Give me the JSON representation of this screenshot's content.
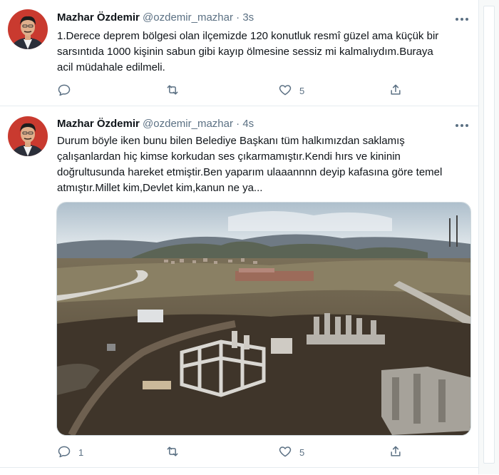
{
  "tweets": [
    {
      "name": "Mazhar Özdemir",
      "handle": "@ozdemir_mazhar",
      "dot": "·",
      "time": "3s",
      "text": "1.Derece deprem bölgesi olan ilçemizde 120 konutluk resmî güzel ama küçük bir sarsıntıda 1000 kişinin sabun gibi kayıp ölmesine sessiz mi kalmalıydım.Buraya acil müdahale edilmeli.",
      "reply_count": "",
      "retweet_count": "",
      "like_count": "5"
    },
    {
      "name": "Mazhar Özdemir",
      "handle": "@ozdemir_mazhar",
      "dot": "·",
      "time": "4s",
      "text": "Durum böyle iken bunu bilen Belediye Başkanı tüm halkımızdan saklamış çalışanlardan hiç kimse korkudan ses çıkarmamıştır.Kendi hırs ve kininin doğrultusunda hareket etmiştir.Ben yaparım ulaaannnn deyip kafasına göre temel atmıştır.Millet kim,Devlet kim,kanun ne ya...",
      "reply_count": "1",
      "retweet_count": "",
      "like_count": "5"
    }
  ],
  "icons": {
    "more": "more-icon",
    "reply": "reply-icon",
    "retweet": "retweet-icon",
    "like": "heart-icon",
    "share": "share-icon"
  },
  "colors": {
    "text": "#0f1419",
    "secondary": "#5b7083",
    "border": "#e6ecf0"
  }
}
